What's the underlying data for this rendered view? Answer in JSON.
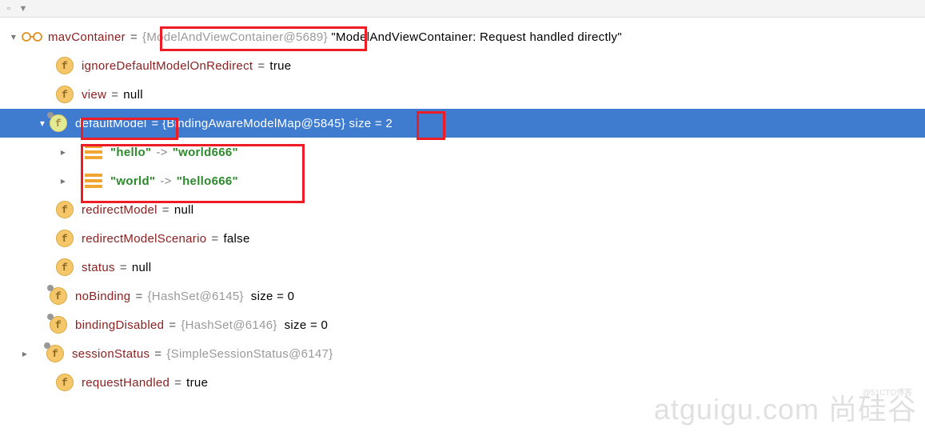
{
  "toolbar": {
    "btn1": "▫",
    "btn2": "▼"
  },
  "root": {
    "mavContainer": {
      "name": "mavContainer",
      "type": "{ModelAndViewContainer@5689}",
      "value": "\"ModelAndViewContainer: Request handled directly\""
    },
    "ignoreDefaultModelOnRedirect": {
      "name": "ignoreDefaultModelOnRedirect",
      "value": "true"
    },
    "view": {
      "name": "view",
      "value": "null"
    },
    "defaultModel": {
      "name": "defaultModel",
      "type_prefix": "= {BindingAwareModelMap@",
      "type_id": "5845",
      "type_suffix": "}  size = 2"
    },
    "entries": [
      {
        "key": "\"hello\"",
        "val": "\"world666\""
      },
      {
        "key": "\"world\"",
        "val": "\"hello666\""
      }
    ],
    "redirectModel": {
      "name": "redirectModel",
      "value": "null"
    },
    "redirectModelScenario": {
      "name": "redirectModelScenario",
      "value": "false"
    },
    "status": {
      "name": "status",
      "value": "null"
    },
    "noBinding": {
      "name": "noBinding",
      "type": "{HashSet@6145}",
      "value": "size = 0"
    },
    "bindingDisabled": {
      "name": "bindingDisabled",
      "type": "{HashSet@6146}",
      "value": "size = 0"
    },
    "sessionStatus": {
      "name": "sessionStatus",
      "type": "{SimpleSessionStatus@6147}"
    },
    "requestHandled": {
      "name": "requestHandled",
      "value": "true"
    }
  },
  "watermark": {
    "main": "atguigu.com 尚硅谷",
    "sub": "@51CTO博客"
  },
  "icons": {
    "f": "f"
  }
}
